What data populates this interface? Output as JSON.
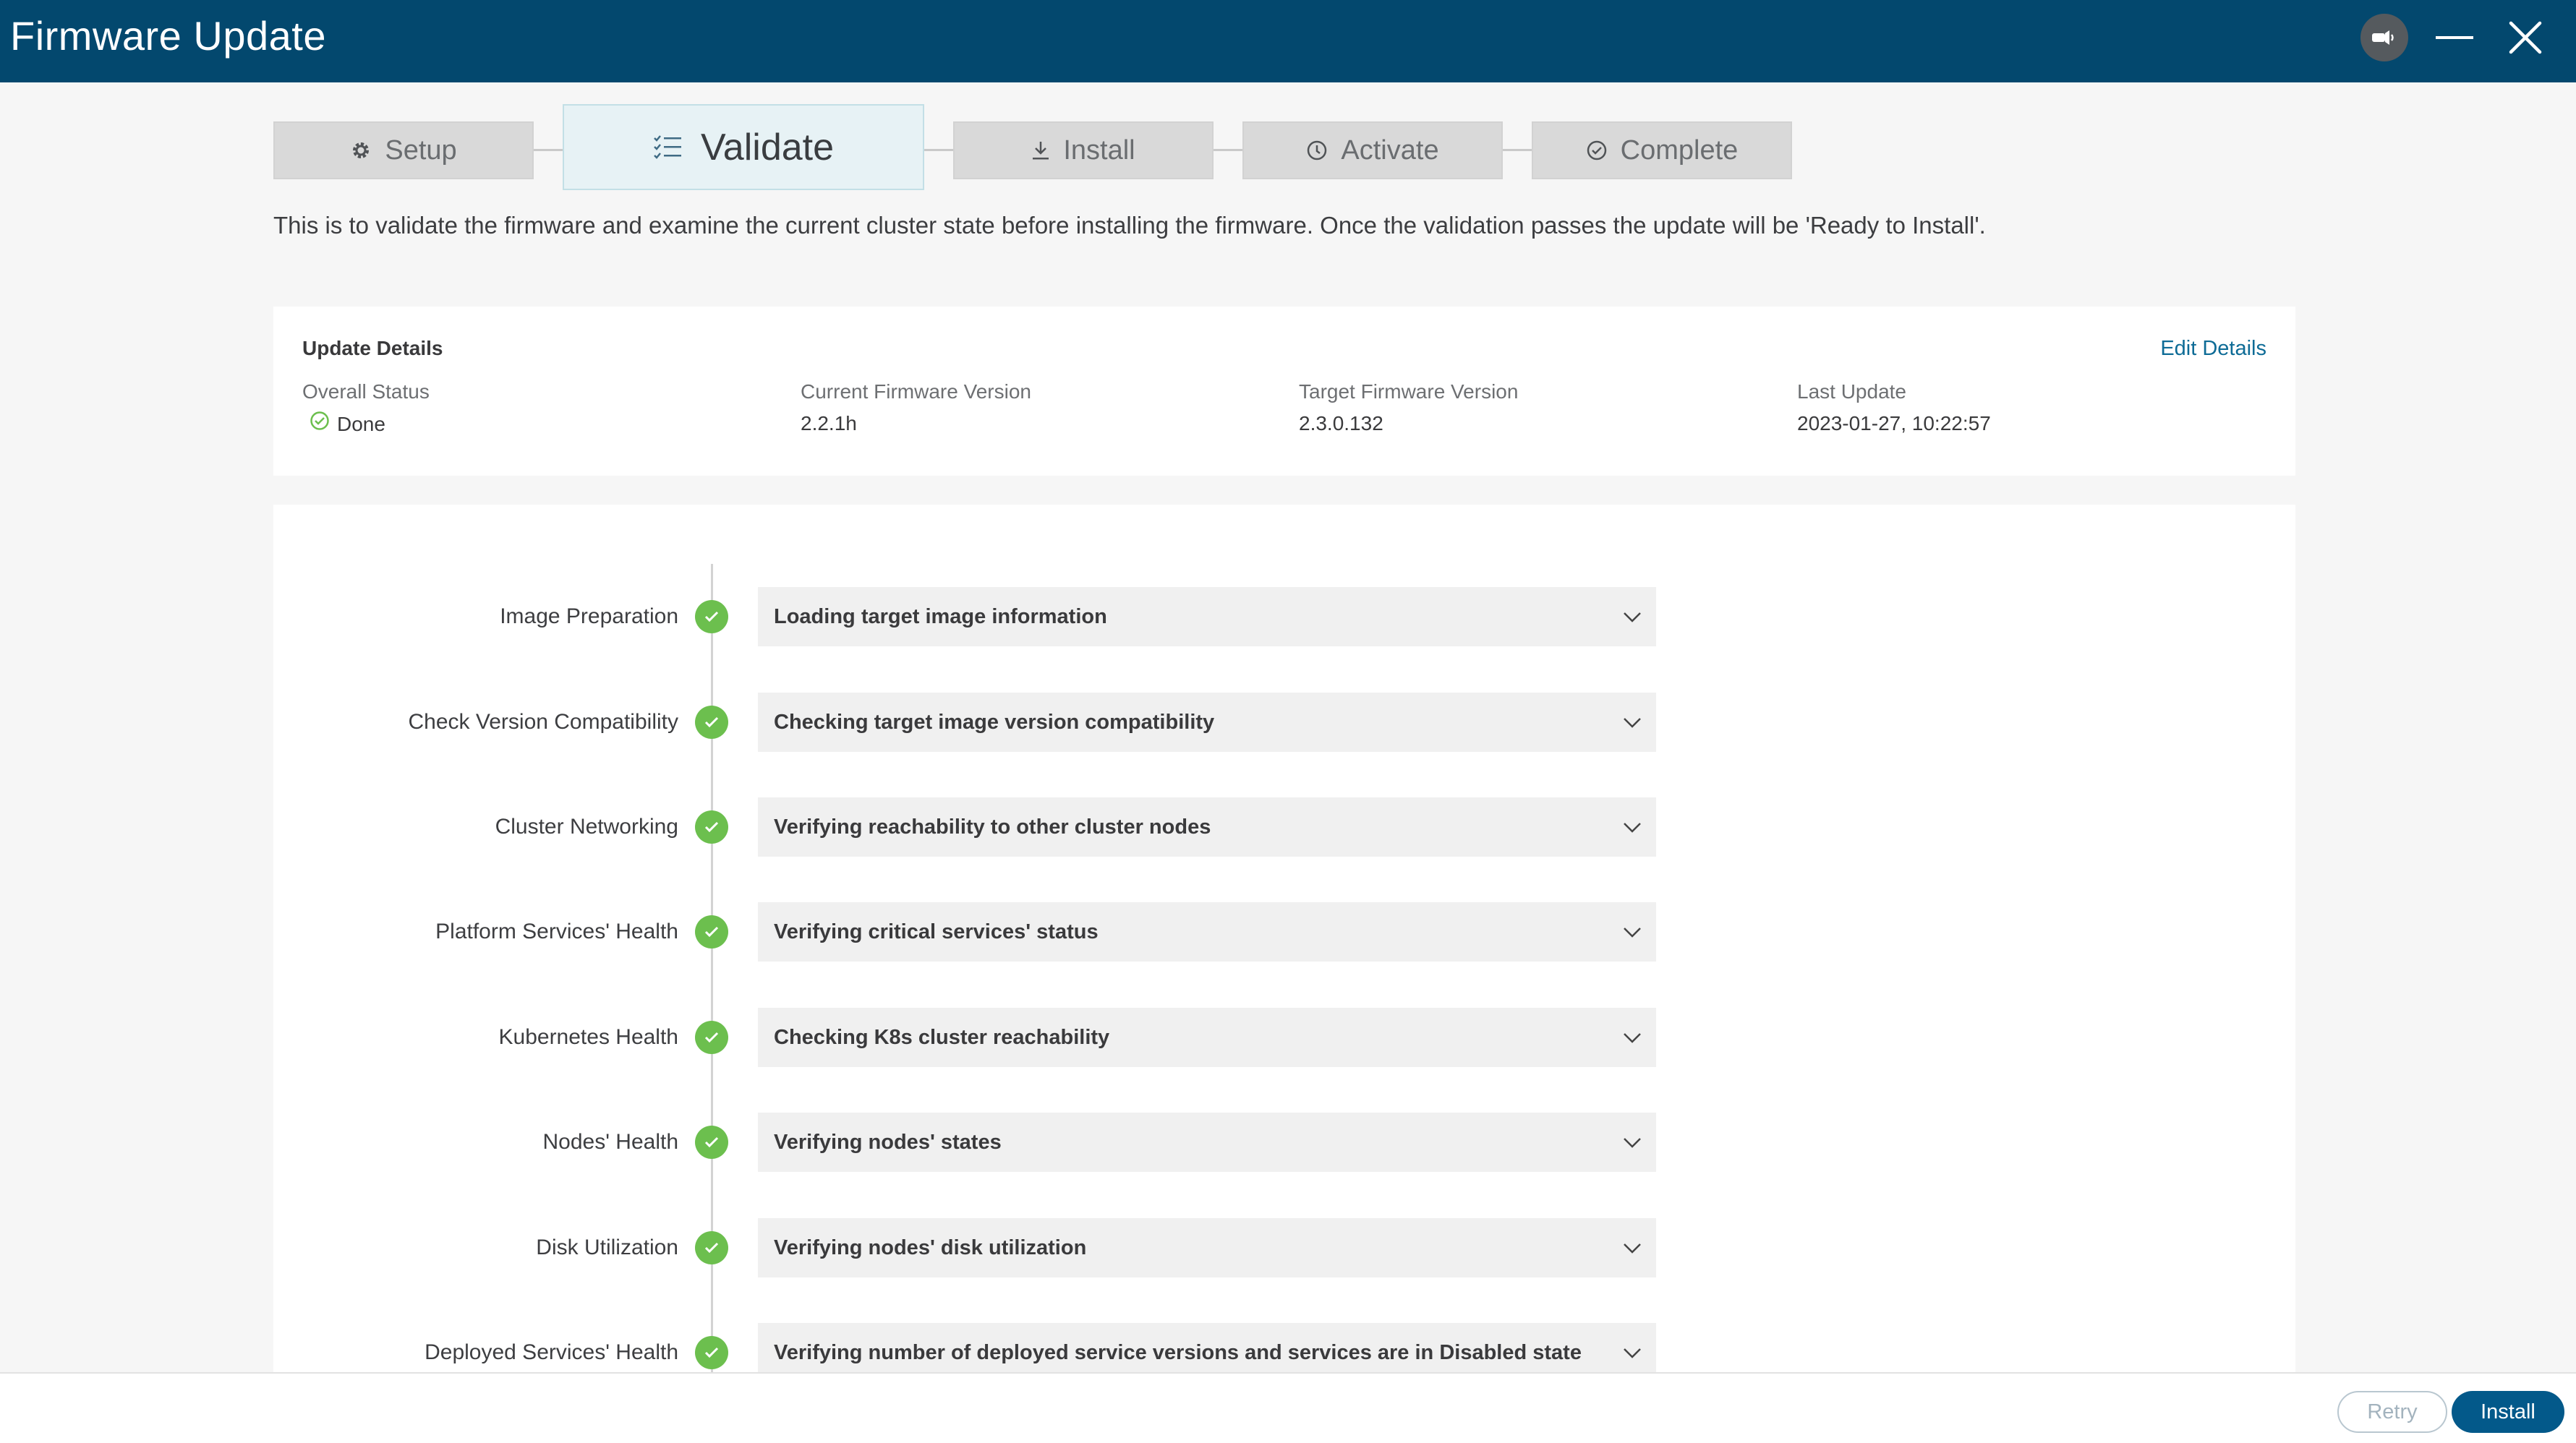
{
  "window": {
    "title": "Firmware Update",
    "icons": {
      "notify": "announcement-icon",
      "minimize": "minimize-icon",
      "close": "close-icon"
    }
  },
  "steps": [
    {
      "label": "Setup",
      "icon": "gear-icon",
      "state": "done"
    },
    {
      "label": "Validate",
      "icon": "checklist-icon",
      "state": "active"
    },
    {
      "label": "Install",
      "icon": "download-icon",
      "state": "pending"
    },
    {
      "label": "Activate",
      "icon": "clock-icon",
      "state": "pending"
    },
    {
      "label": "Complete",
      "icon": "check-circle-icon",
      "state": "pending"
    }
  ],
  "intro": "This is to validate the firmware and examine the current cluster state before installing the firmware. Once the validation passes the update will be 'Ready to Install'.",
  "details": {
    "heading": "Update Details",
    "edit_link": "Edit Details",
    "overall_status_label": "Overall Status",
    "overall_status_value": "Done",
    "current_version_label": "Current Firmware Version",
    "current_version_value": "2.2.1h",
    "target_version_label": "Target Firmware Version",
    "target_version_value": "2.3.0.132",
    "last_update_label": "Last Update",
    "last_update_value": "2023-01-27, 10:22:57"
  },
  "checks": [
    {
      "name": "Image Preparation",
      "description": "Loading target image information",
      "status": "passed"
    },
    {
      "name": "Check Version Compatibility",
      "description": "Checking target image version compatibility",
      "status": "passed"
    },
    {
      "name": "Cluster Networking",
      "description": "Verifying reachability to other cluster nodes",
      "status": "passed"
    },
    {
      "name": "Platform Services' Health",
      "description": "Verifying critical services' status",
      "status": "passed"
    },
    {
      "name": "Kubernetes Health",
      "description": "Checking K8s cluster reachability",
      "status": "passed"
    },
    {
      "name": "Nodes' Health",
      "description": "Verifying nodes' states",
      "status": "passed"
    },
    {
      "name": "Disk Utilization",
      "description": "Verifying nodes' disk utilization",
      "status": "passed"
    },
    {
      "name": "Deployed Services' Health",
      "description": "Verifying number of deployed service versions and services are in Disabled state",
      "status": "passed"
    }
  ],
  "footer": {
    "retry_label": "Retry",
    "install_label": "Install"
  },
  "colors": {
    "titlebar": "#03486e",
    "success": "#6cbf4e",
    "link": "#0d6b96",
    "primary_button": "#03598a"
  }
}
